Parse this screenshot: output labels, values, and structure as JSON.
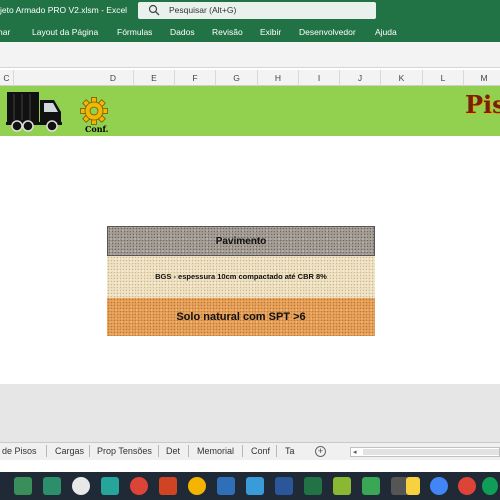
{
  "window": {
    "title": "jeto Armado PRO V2.xlsm  -  Excel"
  },
  "search": {
    "placeholder": "Pesquisar (Alt+G)"
  },
  "ribbon_tabs": [
    "har",
    "Layout da Página",
    "Fórmulas",
    "Dados",
    "Revisão",
    "Exibir",
    "Desenvolvedor",
    "Ajuda"
  ],
  "columns": [
    "C",
    "D",
    "E",
    "F",
    "G",
    "H",
    "I",
    "J",
    "K",
    "L",
    "M"
  ],
  "banner": {
    "conf_label": "Conf.",
    "title": "Piso",
    "color": "#92d050"
  },
  "layers": [
    {
      "label": "Pavimento"
    },
    {
      "label": "BGS - espessura 10cm compactado até CBR 8%"
    },
    {
      "label": "Solo natural com SPT >6"
    }
  ],
  "sheet_tabs": [
    "de Pisos",
    "Cargas",
    "Prop Tensões",
    "Det",
    "Memorial",
    "Conf",
    "Ta"
  ],
  "add_sheet_symbol": "+",
  "scroll_left_symbol": "◂",
  "taskbar_icons": [
    "app-icon",
    "photos-icon",
    "chrome-icon",
    "app-icon",
    "chrome-icon",
    "powerpoint-icon",
    "chrome-icon",
    "visual-studio-icon",
    "app-icon",
    "word-icon",
    "excel-icon",
    "app-icon",
    "camtasia-icon",
    "app-icon",
    "sticky-notes-icon",
    "chrome-icon",
    "chrome-icon",
    "chrome-icon"
  ],
  "colors": {
    "accent": "#217346",
    "banner": "#92d050",
    "taskbar": "#1f2a36"
  }
}
